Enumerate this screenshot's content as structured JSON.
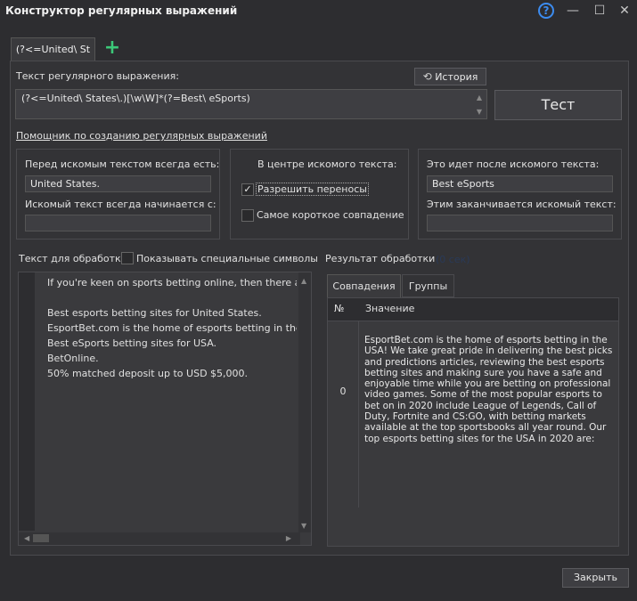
{
  "window": {
    "title": "Конструктор регулярных выражений",
    "help_icon": "?",
    "minimize_icon": "—",
    "maximize_icon": "☐",
    "close_icon": "✕"
  },
  "tabs": {
    "active_label": "(?<=United\\ St",
    "add_icon": "+"
  },
  "regex": {
    "label": "Текст регулярного выражения:",
    "history_button": "История",
    "value": "(?<=United\\ States\\.)[\\w\\W]*(?=Best\\ eSports)",
    "test_button": "Тест"
  },
  "helper_link": "Помощник по созданию регулярных выражений",
  "before": {
    "label_before": "Перед искомым текстом всегда есть:",
    "before_value": "United States.",
    "label_starts": "Искомый текст всегда начинается с:",
    "starts_value": ""
  },
  "middle": {
    "label": "В центре искомого текста:",
    "allow_wrap_label": "Разрешить переносы",
    "allow_wrap_checked": true,
    "shortest_label": "Самое короткое совпадение",
    "shortest_checked": false
  },
  "after": {
    "label_after": "Это идет после искомого текста:",
    "after_value": "Best eSports",
    "label_ends": "Этим заканчивается искомый текст:",
    "ends_value": ""
  },
  "input_text": {
    "label": "Текст для обработки",
    "show_special_label": "Показывать специальные символы",
    "show_special_checked": false,
    "lines": [
      "If you're keen on sports betting online, then there aren't m",
      "",
      "Best esports betting sites for United States.",
      "EsportBet.com is the home of esports betting in the USA! W",
      "Best eSports betting sites for USA.",
      "BetOnline.",
      "50% matched deposit up to USD $5,000."
    ]
  },
  "result": {
    "label": "Результат обработки",
    "time": "(0 сек)",
    "tab_matches": "Совпадения",
    "tab_groups": "Группы",
    "col_no": "№",
    "col_value": "Значение",
    "row_index": "0",
    "row_value": "EsportBet.com is the home of esports betting in the USA! We take great pride in delivering the best picks and predictions articles, reviewing the best esports betting sites and making sure you have a safe and enjoyable time while you are betting on professional video games. Some of the most popular esports to bet on in 2020 include League of Legends, Call of Duty, Fortnite and CS:GO, with betting markets available at the top sportsbooks all year round. Our top esports betting sites for the USA in 2020 are:"
  },
  "close_button": "Закрыть",
  "colors": {
    "background": "#2d2d30",
    "accent_green": "#3cc878",
    "help_blue": "#3c8cf0"
  }
}
